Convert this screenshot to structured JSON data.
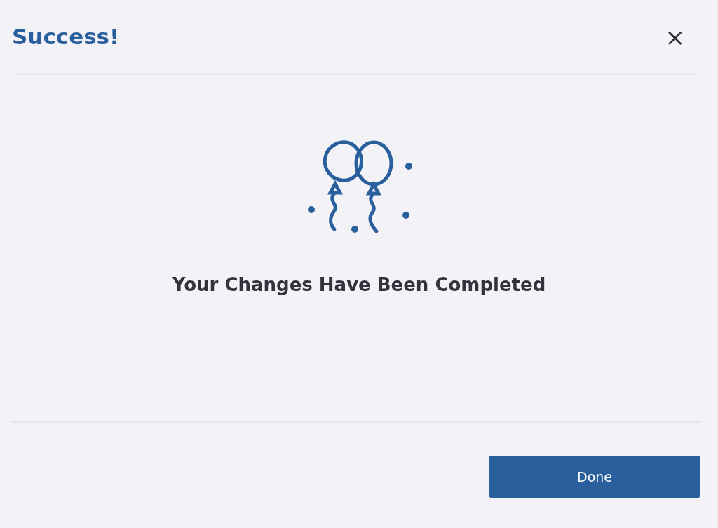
{
  "dialog": {
    "title": "Success!",
    "close": "×",
    "message": "Your Changes Have Been Completed",
    "buttons": [
      {
        "label": "Done",
        "kind": "primary"
      }
    ]
  }
}
